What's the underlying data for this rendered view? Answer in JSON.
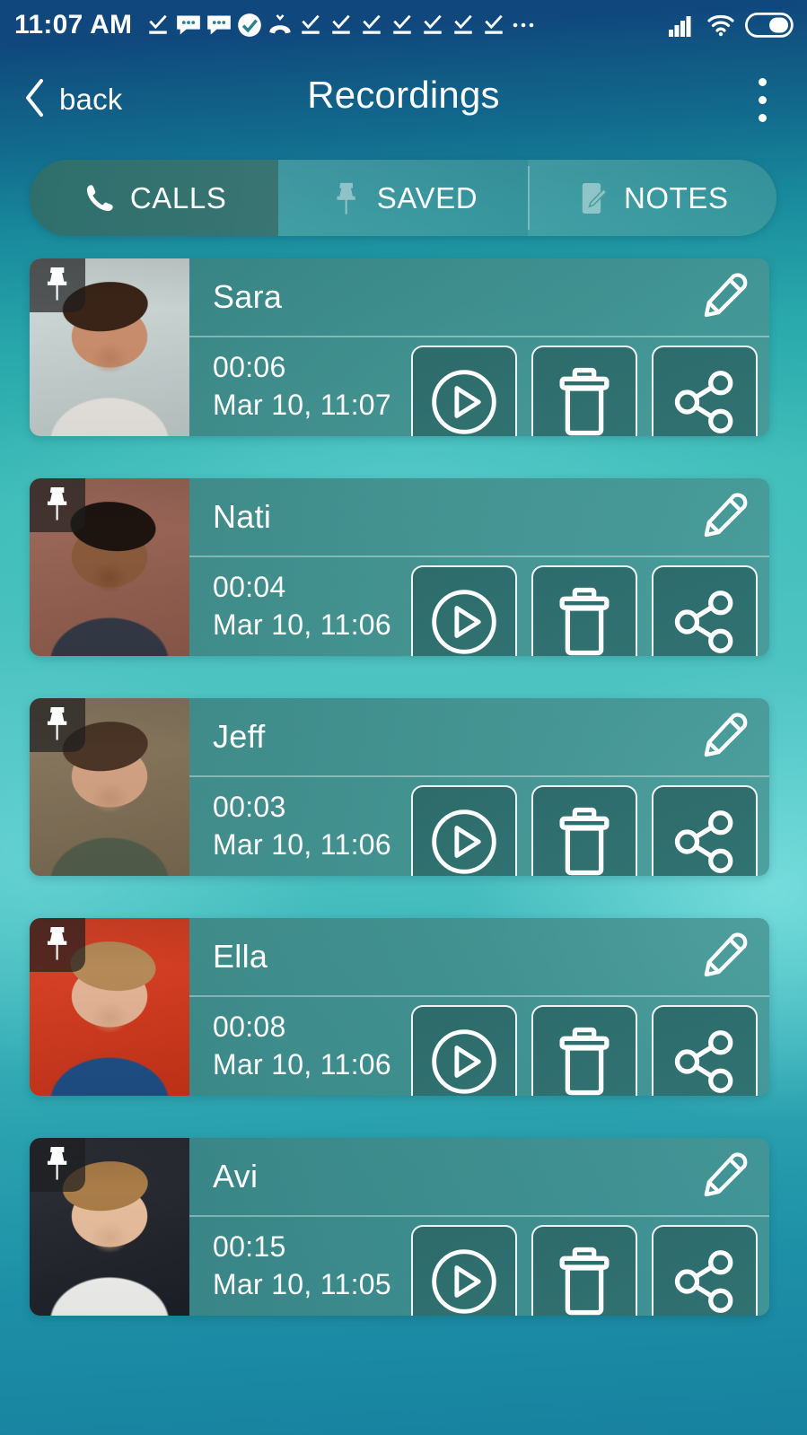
{
  "status_bar": {
    "clock": "11:07 AM",
    "left_icons": [
      "download-done-icon",
      "chat-bubble-icon",
      "chat-bubble-icon",
      "check-circle-icon",
      "missed-call-icon",
      "download-done-icon",
      "download-done-icon",
      "download-done-icon",
      "download-done-icon",
      "download-done-icon",
      "download-done-icon",
      "download-done-icon",
      "more-dots-icon"
    ],
    "right_icons": [
      "cellular-signal-icon",
      "wifi-icon",
      "battery-icon"
    ]
  },
  "app_bar": {
    "back_label": "back",
    "back_icon": "chevron-left-icon",
    "title": "Recordings",
    "overflow_icon": "more-vertical-icon"
  },
  "tabs": [
    {
      "id": "calls",
      "label": "CALLS",
      "icon": "phone-icon",
      "active": true
    },
    {
      "id": "saved",
      "label": "SAVED",
      "icon": "pin-icon",
      "active": false
    },
    {
      "id": "notes",
      "label": "NOTES",
      "icon": "note-edit-icon",
      "active": false
    }
  ],
  "colors": {
    "accent_teal": "#49c0c0",
    "deep_blue": "#10477d",
    "card_bg": "#3f8583",
    "active_tab": "#34726f",
    "text_on_dark": "#ffffff"
  },
  "recordings": [
    {
      "name": "Sara",
      "duration": "00:06",
      "datetime": "Mar 10, 11:07",
      "pinned": true,
      "pin_icon": "pin-icon",
      "edit_icon": "pencil-icon",
      "actions": [
        {
          "name": "play",
          "icon": "play-circle-icon"
        },
        {
          "name": "delete",
          "icon": "trash-icon"
        },
        {
          "name": "share",
          "icon": "share-nodes-icon"
        }
      ],
      "photo": {
        "skin": "#c98e6e",
        "hair": "#3a2418",
        "cloth": "#e9e6e2",
        "bg": "#cfd9d8"
      }
    },
    {
      "name": "Nati",
      "duration": "00:04",
      "datetime": "Mar 10, 11:06",
      "pinned": true,
      "pin_icon": "pin-icon",
      "edit_icon": "pencil-icon",
      "actions": [
        {
          "name": "play",
          "icon": "play-circle-icon"
        },
        {
          "name": "delete",
          "icon": "trash-icon"
        },
        {
          "name": "share",
          "icon": "share-nodes-icon"
        }
      ],
      "photo": {
        "skin": "#8a5a3c",
        "hair": "#1d1410",
        "cloth": "#343a46",
        "bg": "#9e6b5c"
      }
    },
    {
      "name": "Jeff",
      "duration": "00:03",
      "datetime": "Mar 10, 11:06",
      "pinned": true,
      "pin_icon": "pin-icon",
      "edit_icon": "pencil-icon",
      "actions": [
        {
          "name": "play",
          "icon": "play-circle-icon"
        },
        {
          "name": "delete",
          "icon": "trash-icon"
        },
        {
          "name": "share",
          "icon": "share-nodes-icon"
        }
      ],
      "photo": {
        "skin": "#d2a183",
        "hair": "#4a3526",
        "cloth": "#545e4b",
        "bg": "#8a7a62"
      }
    },
    {
      "name": "Ella",
      "duration": "00:08",
      "datetime": "Mar 10, 11:06",
      "pinned": true,
      "pin_icon": "pin-icon",
      "edit_icon": "pencil-icon",
      "actions": [
        {
          "name": "play",
          "icon": "play-circle-icon"
        },
        {
          "name": "delete",
          "icon": "trash-icon"
        },
        {
          "name": "share",
          "icon": "share-nodes-icon"
        }
      ],
      "photo": {
        "skin": "#e2b394",
        "hair": "#b58a58",
        "cloth": "#1f4f86",
        "bg": "#d9452a"
      }
    },
    {
      "name": "Avi",
      "duration": "00:15",
      "datetime": "Mar 10, 11:05",
      "pinned": true,
      "pin_icon": "pin-icon",
      "edit_icon": "pencil-icon",
      "actions": [
        {
          "name": "play",
          "icon": "play-circle-icon"
        },
        {
          "name": "delete",
          "icon": "trash-icon"
        },
        {
          "name": "share",
          "icon": "share-nodes-icon"
        }
      ],
      "photo": {
        "skin": "#e6bd9c",
        "hair": "#a97c48",
        "cloth": "#f2f2f0",
        "bg": "#2e3138"
      }
    }
  ]
}
